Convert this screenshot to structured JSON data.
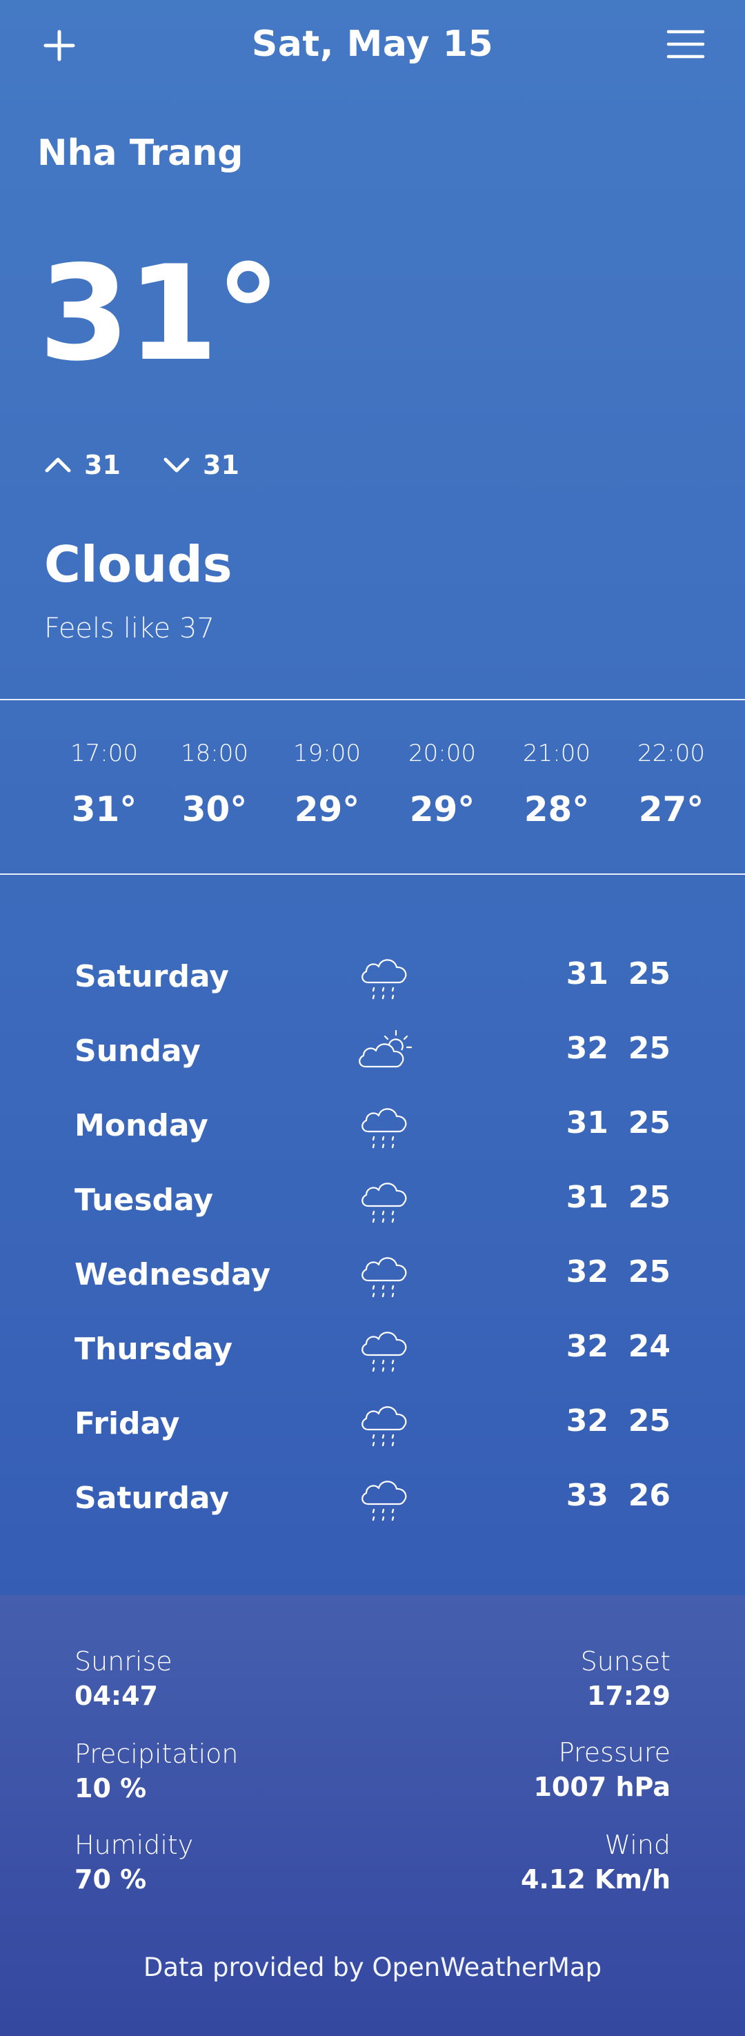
{
  "header": {
    "date": "Sat, May 15",
    "add_icon": "plus-icon",
    "menu_icon": "hamburger-menu-icon"
  },
  "current": {
    "city": "Nha Trang",
    "temperature": "31°",
    "high": "31",
    "low": "31",
    "condition": "Clouds",
    "feels_like": "Feels like 37"
  },
  "hourly": [
    {
      "time": "17:00",
      "temp": "31°"
    },
    {
      "time": "18:00",
      "temp": "30°"
    },
    {
      "time": "19:00",
      "temp": "29°"
    },
    {
      "time": "20:00",
      "temp": "29°"
    },
    {
      "time": "21:00",
      "temp": "28°"
    },
    {
      "time": "22:00",
      "temp": "27°"
    }
  ],
  "daily": [
    {
      "day": "Saturday",
      "icon": "rain-cloud-icon",
      "max": "31",
      "min": "25"
    },
    {
      "day": "Sunday",
      "icon": "partly-sunny-icon",
      "max": "32",
      "min": "25"
    },
    {
      "day": "Monday",
      "icon": "rain-cloud-icon",
      "max": "31",
      "min": "25"
    },
    {
      "day": "Tuesday",
      "icon": "rain-cloud-icon",
      "max": "31",
      "min": "25"
    },
    {
      "day": "Wednesday",
      "icon": "rain-cloud-icon",
      "max": "32",
      "min": "25"
    },
    {
      "day": "Thursday",
      "icon": "rain-cloud-icon",
      "max": "32",
      "min": "24"
    },
    {
      "day": "Friday",
      "icon": "rain-cloud-icon",
      "max": "32",
      "min": "25"
    },
    {
      "day": "Saturday",
      "icon": "rain-cloud-icon",
      "max": "33",
      "min": "26"
    }
  ],
  "details": {
    "sunrise_label": "Sunrise",
    "sunrise": "04:47",
    "sunset_label": "Sunset",
    "sunset": "17:29",
    "precipitation_label": "Precipitation",
    "precipitation": "10 %",
    "pressure_label": "Pressure",
    "pressure": "1007 hPa",
    "humidity_label": "Humidity",
    "humidity": "70 %",
    "wind_label": "Wind",
    "wind": "4.12 Km/h"
  },
  "footer": {
    "credit": "Data provided by OpenWeatherMap"
  },
  "colors": {
    "background_top": "#4479c4",
    "background_bottom": "#355db4",
    "footer_top": "#455fae",
    "footer_bottom": "#34489f",
    "text": "#ffffff"
  }
}
